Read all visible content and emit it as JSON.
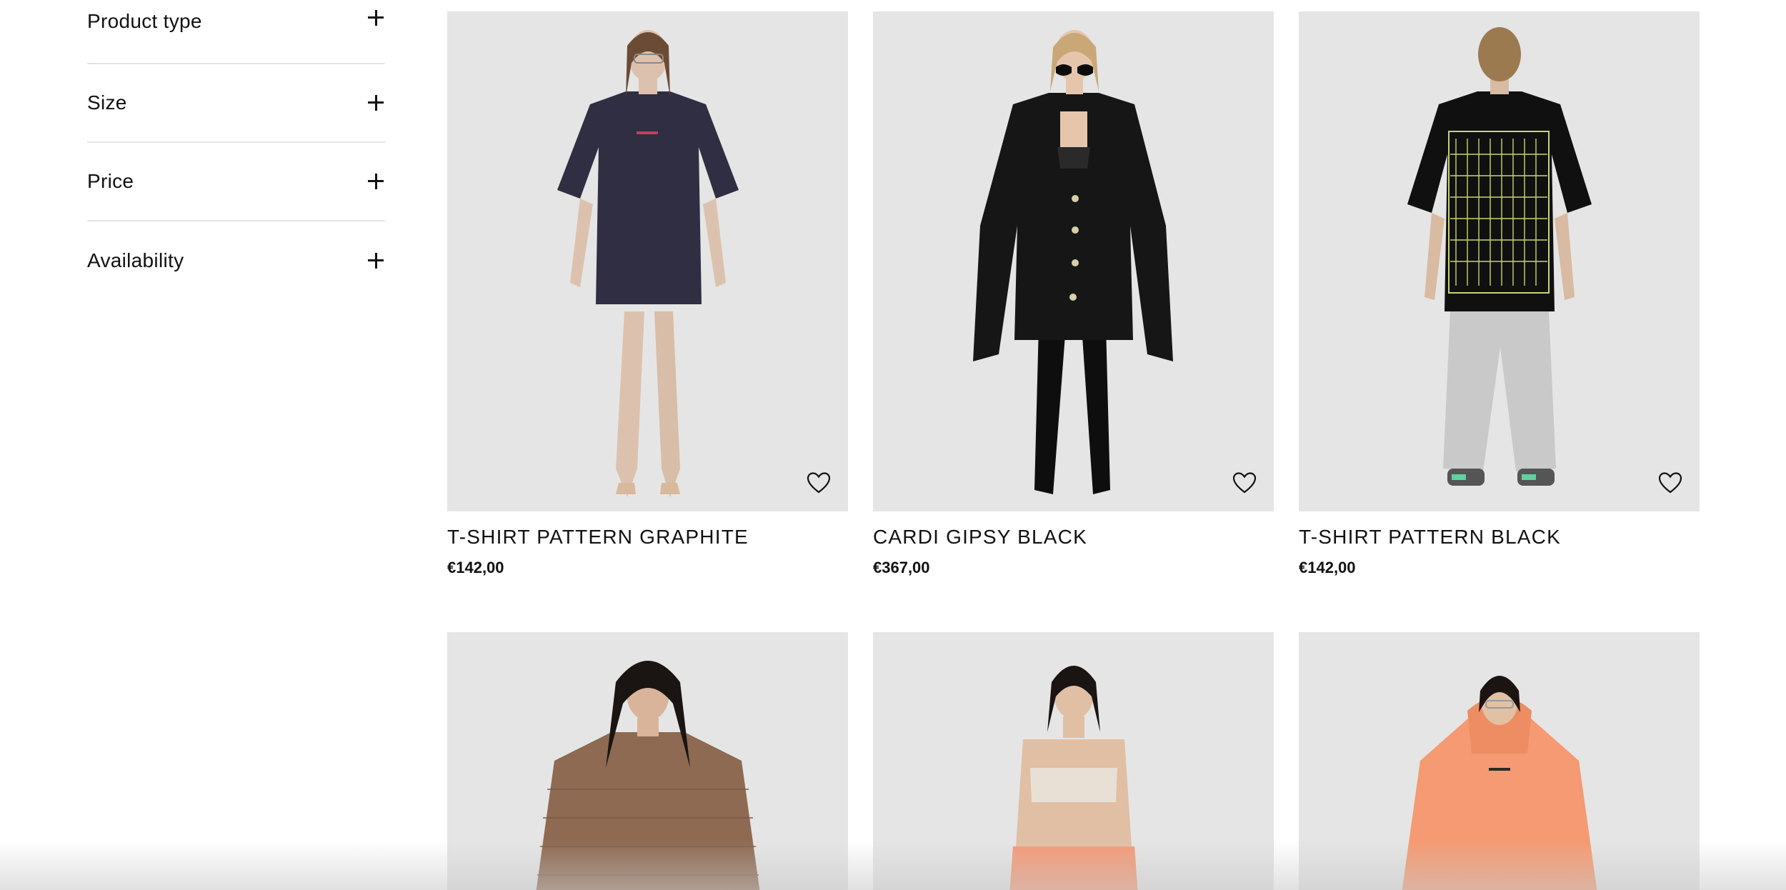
{
  "filters": [
    {
      "label": "Product type"
    },
    {
      "label": "Size"
    },
    {
      "label": "Price"
    },
    {
      "label": "Availability"
    }
  ],
  "products": [
    {
      "title": "T-SHIRT PATTERN GRAPHITE",
      "price": "€142,00",
      "image": "model-graphite-tshirt"
    },
    {
      "title": "CARDI GIPSY BLACK",
      "price": "€367,00",
      "image": "model-black-cardigan"
    },
    {
      "title": "T-SHIRT PATTERN BLACK",
      "price": "€142,00",
      "image": "model-black-tshirt-back"
    },
    {
      "image": "model-brown-knit"
    },
    {
      "image": "model-cream-top-peach-pants"
    },
    {
      "image": "model-peach-hoodie"
    }
  ],
  "colors": {
    "image_bg": "#e5e5e5",
    "text": "#111111",
    "divider": "#e3e3e3"
  }
}
